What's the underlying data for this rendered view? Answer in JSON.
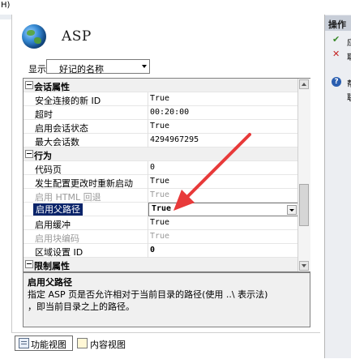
{
  "menu": {
    "help_fragment": "H)"
  },
  "header": {
    "title": "ASP"
  },
  "display": {
    "label": "显示:",
    "value": "好记的名称"
  },
  "grid": {
    "rows": [
      {
        "kind": "cat",
        "name": "会话属性",
        "value": ""
      },
      {
        "kind": "item",
        "name": "安全连接的新 ID",
        "value": "True"
      },
      {
        "kind": "item",
        "name": "超时",
        "value": "00:20:00"
      },
      {
        "kind": "item",
        "name": "启用会话状态",
        "value": "True"
      },
      {
        "kind": "item",
        "name": "最大会话数",
        "value": "4294967295"
      },
      {
        "kind": "cat",
        "name": "行为",
        "value": ""
      },
      {
        "kind": "item",
        "name": "代码页",
        "value": "0"
      },
      {
        "kind": "item",
        "name": "发生配置更改时重新启动",
        "value": "True"
      },
      {
        "kind": "item-disabled",
        "name": "启用 HTML 回退",
        "value": "True"
      },
      {
        "kind": "item-selected",
        "name": "启用父路径",
        "value": "True"
      },
      {
        "kind": "item",
        "name": "启用缓冲",
        "value": "True"
      },
      {
        "kind": "item-disabled",
        "name": "启用块编码",
        "value": "True"
      },
      {
        "kind": "item",
        "name": "区域设置 ID",
        "value": "0"
      },
      {
        "kind": "cat",
        "name": "限制属性",
        "value": ""
      }
    ]
  },
  "description": {
    "title": "启用父路径",
    "line1": "指定 ASP 页是否允许相对于当前目录的路径(使用 ..\\ 表示法)",
    "line2": "，即当前目录之上的路径。"
  },
  "view_tabs": {
    "features": "功能视图",
    "content": "内容视图"
  },
  "actions": {
    "title": "操作",
    "apply_fragment": "应",
    "cancel_fragment": "取",
    "help_fragment": "帮",
    "help_fragment2": "联"
  },
  "colors": {
    "selection": "#0a246a",
    "annotation_arrow": "#e83a3a"
  }
}
